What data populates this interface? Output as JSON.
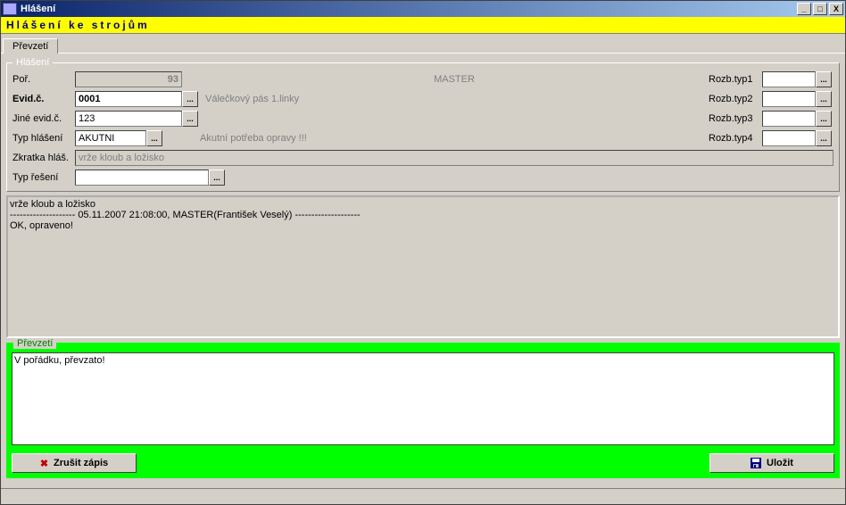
{
  "window": {
    "title": "Hlášení"
  },
  "banner": "Hlášení ke strojům",
  "tab": "Převzetí",
  "hlaseni": {
    "legend": "Hlášení",
    "por_label": "Poř.",
    "por_value": "93",
    "master": "MASTER",
    "evidc_label": "Evid.č.",
    "evidc_value": "0001",
    "evidc_desc": "Válečkový pás 1.linky",
    "jine_label": "Jiné evid.č.",
    "jine_value": "123",
    "typh_label": "Typ hlášení",
    "typh_value": "AKUTNI",
    "typh_desc": "Akutní potřeba opravy !!!",
    "zkratka_label": "Zkratka hláš.",
    "zkratka_value": "vrže kloub a ložisko",
    "typr_label": "Typ řešení",
    "typr_value": "",
    "rozb1_label": "Rozb.typ1",
    "rozb2_label": "Rozb.typ2",
    "rozb3_label": "Rozb.typ3",
    "rozb4_label": "Rozb.typ4",
    "rozb1": "",
    "rozb2": "",
    "rozb3": "",
    "rozb4": "",
    "log": "vrže kloub a ložisko\n-------------------- 05.11.2007 21:08:00, MASTER(František Veselý) --------------------\nOK, opraveno!"
  },
  "prevzeti": {
    "legend": "Převzetí",
    "text": "V pořádku, převzato!"
  },
  "buttons": {
    "cancel": "Zrušit zápis",
    "save": "Uložit"
  },
  "ell": "..."
}
